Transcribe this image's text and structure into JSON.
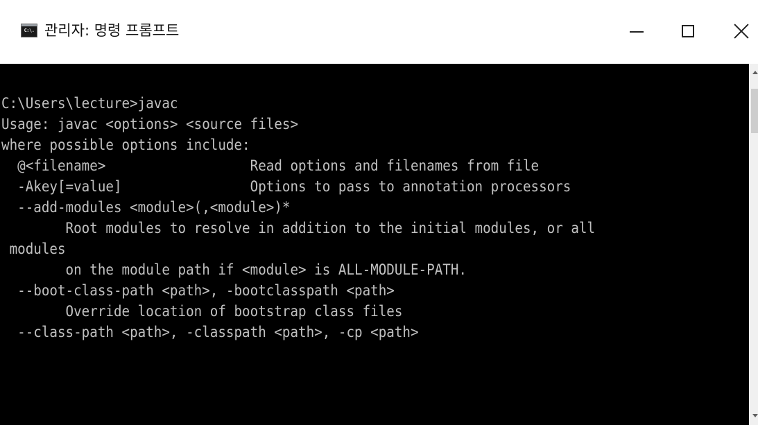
{
  "window": {
    "title": "관리자: 명령 프롬프트",
    "icon_name": "cmd-icon",
    "icon_text": "C:\\."
  },
  "titlebar": {
    "minimize_icon": "minimize-icon",
    "maximize_icon": "maximize-icon",
    "close_icon": "close-icon"
  },
  "console": {
    "lines": [
      "C:\\Users\\lecture>javac",
      "Usage: javac <options> <source files>",
      "where possible options include:",
      "  @<filename>                  Read options and filenames from file",
      "  -Akey[=value]                Options to pass to annotation processors",
      "  --add-modules <module>(,<module>)*",
      "        Root modules to resolve in addition to the initial modules, or all",
      " modules",
      "        on the module path if <module> is ALL-MODULE-PATH.",
      "  --boot-class-path <path>, -bootclasspath <path>",
      "        Override location of bootstrap class files",
      "  --class-path <path>, -classpath <path>, -cp <path>"
    ]
  },
  "colors": {
    "console_background": "#000000",
    "console_text": "#c0c0c0",
    "titlebar_background": "#ffffff"
  }
}
